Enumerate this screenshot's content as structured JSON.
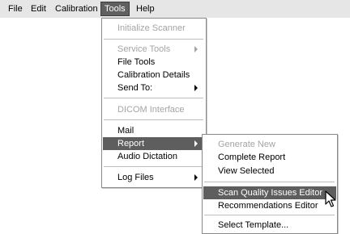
{
  "menubar": {
    "items": [
      {
        "label": "File"
      },
      {
        "label": "Edit"
      },
      {
        "label": "Calibration"
      },
      {
        "label": "Tools"
      },
      {
        "label": "Help"
      }
    ]
  },
  "tools_menu": {
    "items": [
      {
        "label": "Initialize Scanner",
        "state": "disabled"
      },
      {
        "label": "Service Tools",
        "state": "disabled",
        "submenu": true
      },
      {
        "label": "File Tools",
        "state": "enabled"
      },
      {
        "label": "Calibration Details",
        "state": "enabled"
      },
      {
        "label": "Send To:",
        "state": "enabled",
        "submenu": true
      },
      {
        "label": "DICOM Interface",
        "state": "disabled"
      },
      {
        "label": "Mail",
        "state": "enabled"
      },
      {
        "label": "Report",
        "state": "highlighted",
        "submenu": true
      },
      {
        "label": "Audio Dictation",
        "state": "enabled"
      },
      {
        "label": "Log Files",
        "state": "enabled",
        "submenu": true
      }
    ]
  },
  "report_submenu": {
    "items": [
      {
        "label": "Generate New",
        "state": "disabled"
      },
      {
        "label": "Complete Report",
        "state": "enabled"
      },
      {
        "label": "View Selected",
        "state": "enabled"
      },
      {
        "label": "Scan Quality Issues Editor",
        "state": "highlighted"
      },
      {
        "label": "Recommendations Editor",
        "state": "enabled"
      },
      {
        "label": "Select Template...",
        "state": "enabled"
      }
    ]
  },
  "colors": {
    "menubar_bg": "#e6e6e6",
    "highlight_bg": "#5e5e5e",
    "disabled_text": "#a4a4a4"
  },
  "cursor": {
    "icon": "arrow-pointer-icon"
  }
}
